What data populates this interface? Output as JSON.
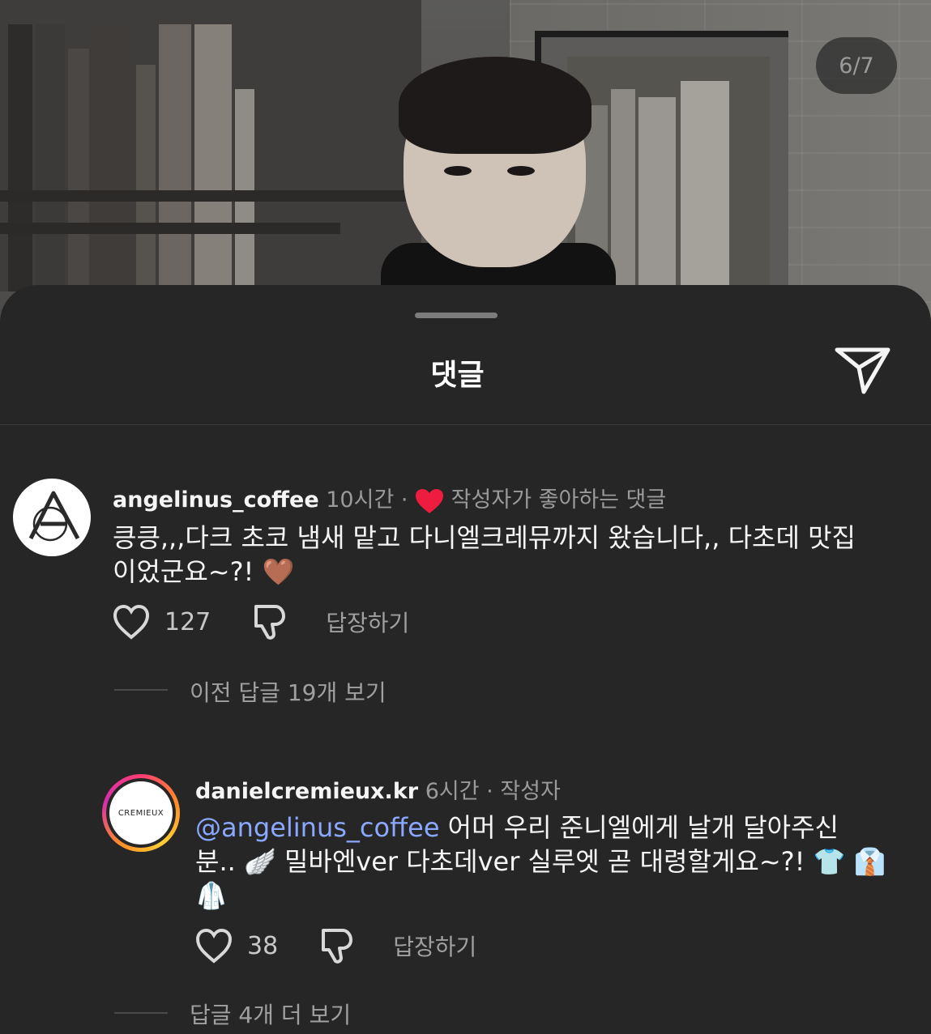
{
  "media": {
    "counter": "6/7"
  },
  "sheet": {
    "title": "댓글"
  },
  "comments": [
    {
      "username": "angelinus_coffee",
      "time": "10시간",
      "dot": "·",
      "liked_by_author": "작성자가 좋아하는 댓글",
      "avatar_text": "A",
      "text_line1": "킁킁,,,다크 초코 냄새 맡고 다니엘크레뮤까지 왔습니다,, 다초데 맛집",
      "text_line2": "이었군요~?! 🤎",
      "likes": "127",
      "reply_label": "답장하기",
      "view_replies": "이전 답글 19개 보기"
    },
    {
      "username": "danielcremieux.kr",
      "time": "6시간",
      "dot": "·",
      "author_badge": "작성자",
      "avatar_text": "CREMIEUX",
      "mention": "@angelinus_coffee",
      "text_line1_rest": " 어머 우리 준니엘에게 날개 달아주신",
      "text_line2": "분.. 🪽  밀바엔ver 다초데ver 실루엣 곧 대령할게요~?! 👕 👔",
      "text_line3": "🥼",
      "likes": "38",
      "reply_label": "답장하기",
      "view_replies": "답글 4개 더 보기"
    }
  ],
  "colors": {
    "background": "#262626",
    "mention": "#8aa8ff",
    "heart": "#ee1d3f"
  }
}
